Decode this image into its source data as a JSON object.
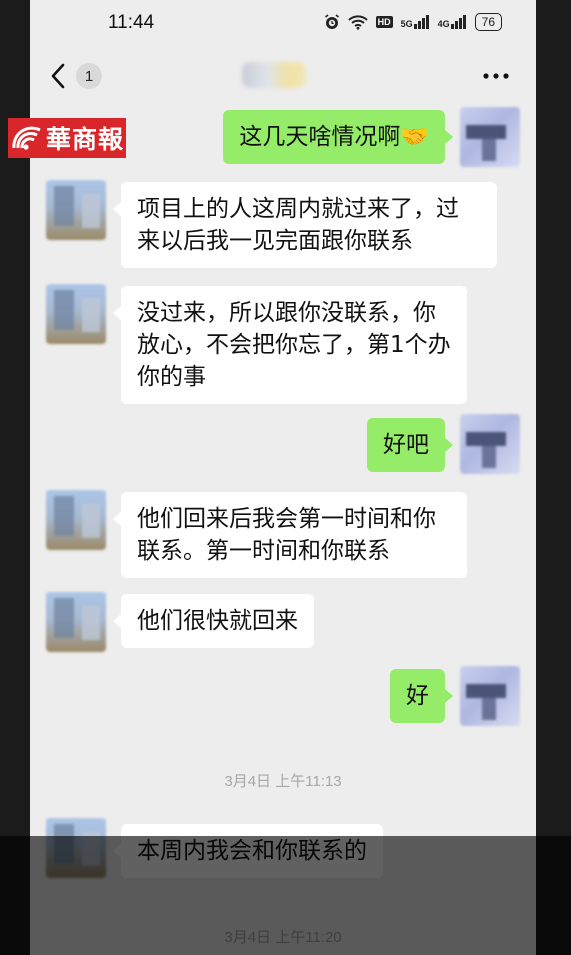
{
  "status_bar": {
    "time": "11:44",
    "hd_label": "HD",
    "signal_1": "5G",
    "signal_2": "4G",
    "battery": "76",
    "icons": [
      "alarm-icon",
      "wifi-icon",
      "hd-icon",
      "signal-5g-icon",
      "signal-4g-icon",
      "battery-icon"
    ]
  },
  "nav": {
    "unread_count": "1",
    "title": "",
    "more_label": "···"
  },
  "logo": {
    "text": "華商報"
  },
  "colors": {
    "sent_bubble": "#95ec69",
    "received_bubble": "#ffffff",
    "background": "#ededed",
    "logo_red": "#d8262a"
  },
  "messages": [
    {
      "side": "out",
      "text": "这几天啥情况啊🤝"
    },
    {
      "side": "in",
      "text": "项目上的人这周内就过来了，过来以后我一见完面跟你联系"
    },
    {
      "side": "in",
      "text": "没过来，所以跟你没联系，你放心，不会把你忘了，第1个办你的事"
    },
    {
      "side": "out",
      "text": "好吧"
    },
    {
      "side": "in",
      "text": "他们回来后我会第一时间和你联系。第一时间和你联系"
    },
    {
      "side": "in",
      "text": "他们很快就回来"
    },
    {
      "side": "out",
      "text": "好"
    },
    {
      "side": "in",
      "text": "本周内我会和你联系的"
    }
  ],
  "timestamps": [
    "3月4日 上午11:13",
    "3月4日 上午11:20"
  ]
}
